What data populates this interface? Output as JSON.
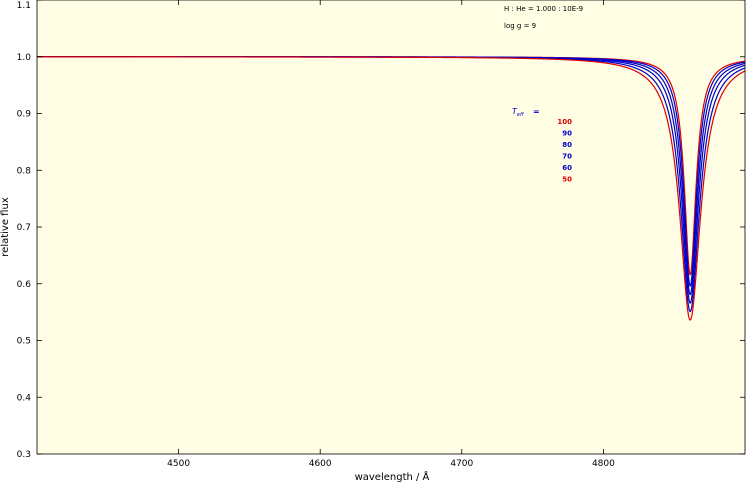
{
  "chart_data": {
    "type": "line",
    "xlabel": "wavelength / Å",
    "ylabel": "relative flux",
    "xlim": [
      4400,
      4900
    ],
    "ylim": [
      0.3,
      1.1
    ],
    "x_ticks": [
      4500,
      4600,
      4700,
      4800
    ],
    "y_ticks": [
      0.3,
      0.4,
      0.5,
      0.6,
      0.7,
      0.8,
      0.9,
      1.0,
      1.1
    ],
    "x_tick_labels": [
      "4500",
      "4600",
      "4700",
      "4800"
    ],
    "y_tick_labels": [
      "0.3",
      "0.4",
      "0.5",
      "0.6",
      "0.7",
      "0.8",
      "0.9",
      "1.0",
      "1.1"
    ],
    "grid": false,
    "background_color": "#fffde3",
    "annotation_abundance": "H : He = 1.000 : 10E-9",
    "annotation_logg": "log g  = 9",
    "legend_prefix": "T",
    "legend_prefix_sub": "eff",
    "legend_equals": "=",
    "line_center": 4861.3,
    "series": [
      {
        "name": "100",
        "color": "#dd0000",
        "min_flux": 0.54,
        "half_width": 9.0
      },
      {
        "name": "90",
        "color": "#0000cc",
        "min_flux": 0.555,
        "half_width": 8.0
      },
      {
        "name": "80",
        "color": "#0000cc",
        "min_flux": 0.57,
        "half_width": 7.0
      },
      {
        "name": "70",
        "color": "#0000cc",
        "min_flux": 0.585,
        "half_width": 6.2
      },
      {
        "name": "60",
        "color": "#0000cc",
        "min_flux": 0.6,
        "half_width": 5.5
      },
      {
        "name": "50",
        "color": "#dd0000",
        "min_flux": 0.62,
        "half_width": 5.0
      }
    ]
  }
}
